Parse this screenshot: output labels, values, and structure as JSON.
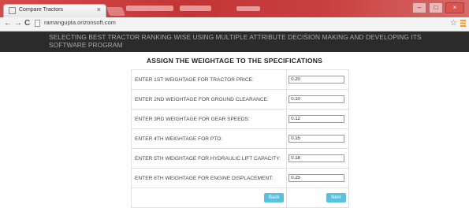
{
  "browser": {
    "tab_title": "Compare Tractors",
    "tab_close": "×",
    "url": "ramangupta.orizonsoft.com",
    "nav": {
      "back": "←",
      "forward": "→",
      "reload": "C"
    },
    "star": "☆",
    "window_controls": {
      "minimize": "–",
      "maximize": "□",
      "close": "×"
    }
  },
  "site": {
    "title": "SELECTING BEST TRACTOR RANKING WISE USING MULTIPLE ATTRIBUTE DECISION MAKING AND DEVELOPING ITS SOFTWARE PROGRAM"
  },
  "form": {
    "title": "ASSIGN THE WEIGHTAGE TO THE SPECIFICATIONS",
    "rows": [
      {
        "label": "ENTER 1ST WEIGHTAGE FOR TRACTOR PRICE:",
        "value": "0.20"
      },
      {
        "label": "ENTER 2ND WEIGHTAGE FOR GROUND CLEARANCE:",
        "value": "0.10"
      },
      {
        "label": "ENTER 3RD WEIGHTAGE FOR GEAR SPEEDS:",
        "value": "0.12"
      },
      {
        "label": "ENTER 4TH WEIGHTAGE FOR PTO:",
        "value": "0.15"
      },
      {
        "label": "ENTER 5TH WEIGHTAGE FOR HYDRAULIC LIFT CAPACITY:",
        "value": "0.18"
      },
      {
        "label": "ENTER 6TH WEIGHTAGE FOR ENGINE DISPLACEMENT:",
        "value": "0.25"
      }
    ],
    "back_label": "Back",
    "next_label": "Next"
  },
  "colors": {
    "titlebar": "#c23535",
    "header_bg": "#2b2b2b",
    "header_text": "#a9a9a9",
    "button": "#5bc0de"
  }
}
